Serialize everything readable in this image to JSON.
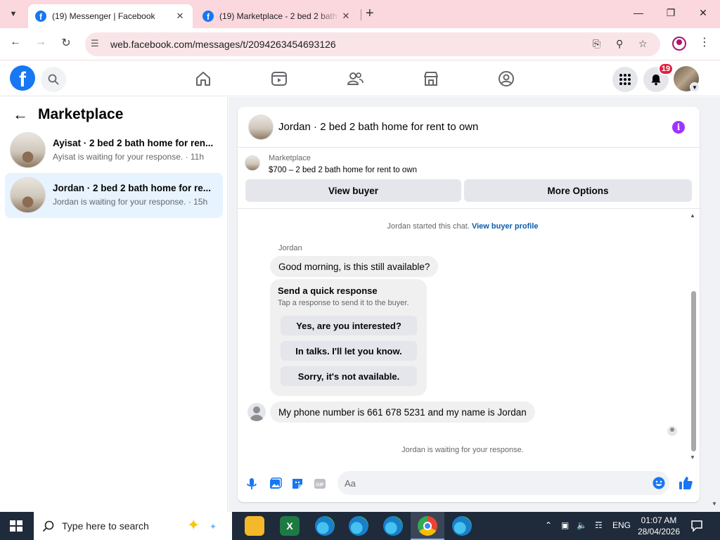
{
  "browser": {
    "tabs": [
      {
        "title": "(19) Messenger | Facebook",
        "active": true
      },
      {
        "title": "(19) Marketplace - 2 bed 2 bath",
        "active": false
      }
    ],
    "url": "web.facebook.com/messages/t/2094263454693126"
  },
  "fb_nav": {
    "notification_count": "19"
  },
  "left_panel": {
    "title": "Marketplace",
    "conversations": [
      {
        "title": "Ayisat · 2 bed 2 bath home for ren...",
        "subtitle": "Ayisat is waiting for your response. · 11h",
        "selected": false
      },
      {
        "title": "Jordan · 2 bed 2 bath home for re...",
        "subtitle": "Jordan is waiting for your response. · 15h",
        "selected": true
      }
    ]
  },
  "chat": {
    "header_title": "Jordan · 2 bed 2 bath home for rent to own",
    "marketplace_label": "Marketplace",
    "listing": "$700 – 2 bed 2 bath home for rent to own",
    "view_buyer": "View buyer",
    "more_options": "More Options",
    "started_text": "Jordan started this chat.",
    "view_buyer_profile": "View buyer profile",
    "sender_name": "Jordan",
    "message_1": "Good morning, is this still available?",
    "quick_response": {
      "title": "Send a quick response",
      "subtitle": "Tap a response to send it to the buyer.",
      "options": [
        "Yes, are you interested?",
        "In talks. I'll let you know.",
        "Sorry, it's not available."
      ]
    },
    "message_2": "My phone number is 661 678 5231 and my name is Jordan",
    "waiting_text": "Jordan is waiting for your response.",
    "composer_placeholder": "Aa"
  },
  "taskbar": {
    "search_placeholder": "Type here to search",
    "language": "ENG",
    "time": "01:07 AM",
    "date": "28/04/2026"
  },
  "colors": {
    "fb_blue": "#1877f2",
    "tabstrip": "#fbd7de",
    "selected_conv": "#e7f3ff",
    "info_purple": "#a033ff",
    "taskbar": "#1f2a3a"
  }
}
